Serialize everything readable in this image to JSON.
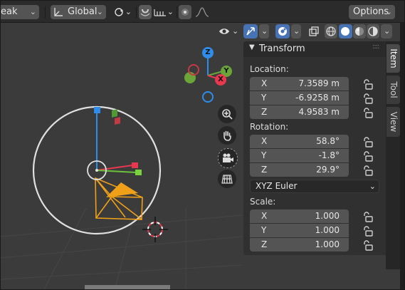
{
  "header": {
    "mode_partial": "eak",
    "orientation_label": "Global",
    "options_label": "Options"
  },
  "panel": {
    "tabs": [
      "Item",
      "Tool",
      "View"
    ],
    "transform_title": "Transform",
    "location": {
      "label": "Location:",
      "x": {
        "axis": "X",
        "value": "7.3589 m"
      },
      "y": {
        "axis": "Y",
        "value": "-6.9258 m"
      },
      "z": {
        "axis": "Z",
        "value": "4.9583 m"
      }
    },
    "rotation": {
      "label": "Rotation:",
      "x": {
        "axis": "X",
        "value": "58.8°"
      },
      "y": {
        "axis": "Y",
        "value": "-1.8°"
      },
      "z": {
        "axis": "Z",
        "value": "29.9°"
      },
      "mode": "XYZ Euler"
    },
    "scale": {
      "label": "Scale:",
      "x": {
        "axis": "X",
        "value": "1.000"
      },
      "y": {
        "axis": "Y",
        "value": "1.000"
      },
      "z": {
        "axis": "Z",
        "value": "1.000"
      }
    }
  },
  "gizmo": {
    "z": "Z",
    "y": "Y",
    "x": "X"
  },
  "colors": {
    "accent_blue": "#4772b3",
    "axis_x": "#e8384f",
    "axis_y": "#6ba53a",
    "axis_z": "#2e8dea",
    "selection_orange": "#f0a018"
  },
  "icons": [
    "transform-orientation-icon",
    "pivot-icon",
    "snap-icon",
    "increment-icon",
    "proportional-icon",
    "falloff-icon",
    "eye-icon",
    "gizmo-icon",
    "overlay-icon",
    "xray-icon",
    "wireframe-icon",
    "solid-icon",
    "material-icon",
    "rendered-icon",
    "zoom-icon",
    "hand-icon",
    "camera-icon",
    "grid-icon",
    "lock-icon",
    "camera-object",
    "cursor-3d"
  ]
}
